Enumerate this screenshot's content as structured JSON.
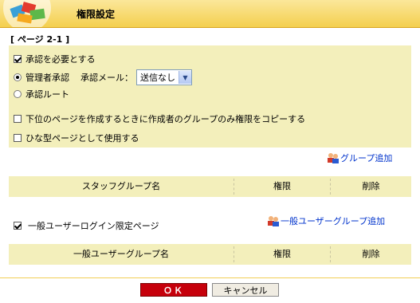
{
  "header": {
    "title": "権限設定"
  },
  "page_label": "[ ページ 2-1 ]",
  "options": {
    "require_approval": {
      "label": "承認を必要とする",
      "checked": true
    },
    "admin_approval": {
      "label": "管理者承認",
      "selected": true
    },
    "approval_mail_label": "承認メール：",
    "approval_mail_value": "送信なし",
    "approval_route": {
      "label": "承認ルート",
      "selected": false
    },
    "copy_group_permission": {
      "label": "下位のページを作成するときに作成者のグループのみ権限をコピーする",
      "checked": false
    },
    "use_as_template": {
      "label": "ひな型ページとして使用する",
      "checked": false
    }
  },
  "staff_group": {
    "add_label": "グループ追加",
    "columns": [
      "スタッフグループ名",
      "権限",
      "削除"
    ]
  },
  "general_user": {
    "login_limit": {
      "label": "一般ユーザーログイン限定ページ",
      "checked": true
    },
    "add_label": "一般ユーザーグループ追加",
    "columns": [
      "一般ユーザーグループ名",
      "権限",
      "削除"
    ]
  },
  "buttons": {
    "ok": "ＯＫ",
    "cancel": "キャンセル"
  }
}
